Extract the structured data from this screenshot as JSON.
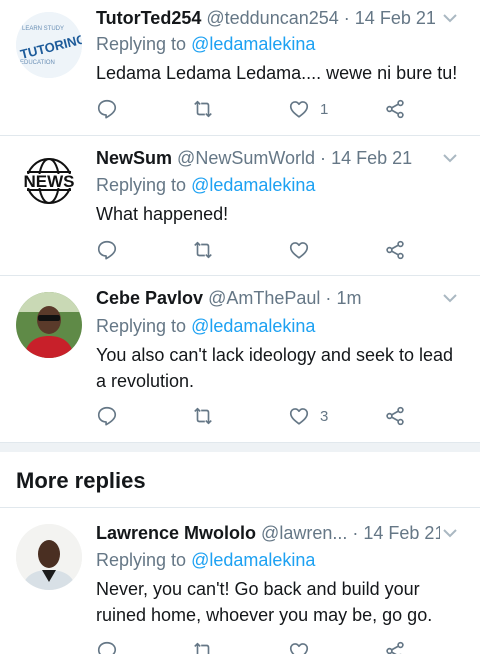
{
  "tweets": [
    {
      "name": "TutorTed254",
      "handle": "@tedduncan254",
      "time": "14 Feb 21",
      "replying_prefix": "Replying to",
      "replying_to": "@ledamalekina",
      "text": "Ledama Ledama Ledama.... wewe ni bure tu!",
      "likes": "1",
      "avatar": "tutoring-logo",
      "avatar_text": "TUTORING"
    },
    {
      "name": "NewSum",
      "handle": "@NewSumWorld",
      "time": "14 Feb 21",
      "replying_prefix": "Replying to",
      "replying_to": "@ledamalekina",
      "text": "What happened!",
      "likes": "",
      "avatar": "news-logo",
      "avatar_text": "NEWS"
    },
    {
      "name": "Cebe Pavlov",
      "handle": "@AmThePaul",
      "time": "1m",
      "replying_prefix": "Replying to",
      "replying_to": "@ledamalekina",
      "text": "You also can't lack ideology and seek to lead a revolution.",
      "likes": "3",
      "avatar": "person-photo"
    },
    {
      "name": "Lawrence Mwololo",
      "handle": "@lawren...",
      "time": "14 Feb 21",
      "replying_prefix": "Replying to",
      "replying_to": "@ledamalekina",
      "text": "Never,  you can't! Go back and build your ruined home, whoever you may be, go go.",
      "likes": "",
      "avatar": "person-photo"
    }
  ],
  "more_replies_label": "More replies",
  "separator": "·",
  "colors": {
    "accent": "#1da1f2",
    "secondary_text": "#657786",
    "divider": "#e1e8ed"
  }
}
